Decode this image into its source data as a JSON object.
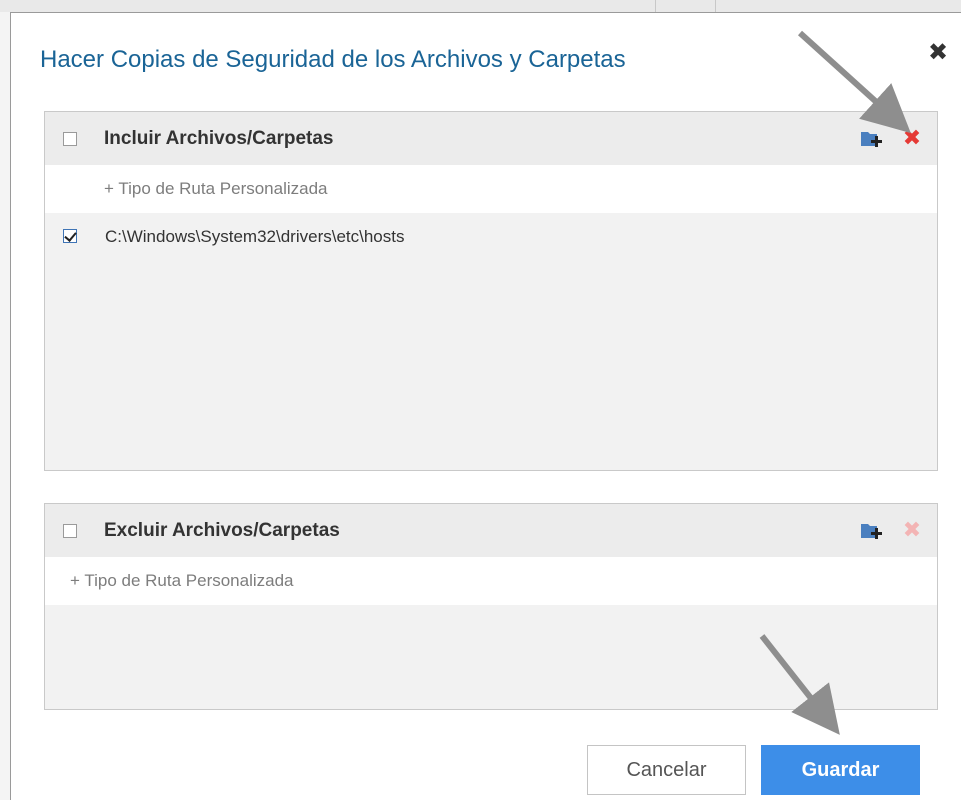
{
  "dialog": {
    "title": "Hacer Copias de Seguridad de los Archivos y Carpetas",
    "close_icon": "close-icon"
  },
  "include_panel": {
    "header_label": "Incluir Archivos/Carpetas",
    "header_checked": false,
    "add_path_label": "+ Tipo de Ruta Personalizada",
    "items": [
      {
        "path": "C:\\Windows\\System32\\drivers\\etc\\hosts",
        "checked": true
      }
    ],
    "icons": [
      "add-folder-icon",
      "delete-icon"
    ],
    "delete_color": "#e53935"
  },
  "exclude_panel": {
    "header_label": "Excluir Archivos/Carpetas",
    "header_checked": false,
    "add_path_label": "+ Tipo de Ruta Personalizada",
    "items": [],
    "icons": [
      "add-folder-icon",
      "delete-icon"
    ],
    "delete_color": "#f3b4b4"
  },
  "buttons": {
    "cancel_label": "Cancelar",
    "save_label": "Guardar"
  },
  "colors": {
    "title": "#1a6496",
    "primary": "#3d8ee8",
    "folder_icon": "#4a7fbf"
  },
  "annotations": [
    "arrow-pointer-icon",
    "arrow-pointer-icon"
  ]
}
